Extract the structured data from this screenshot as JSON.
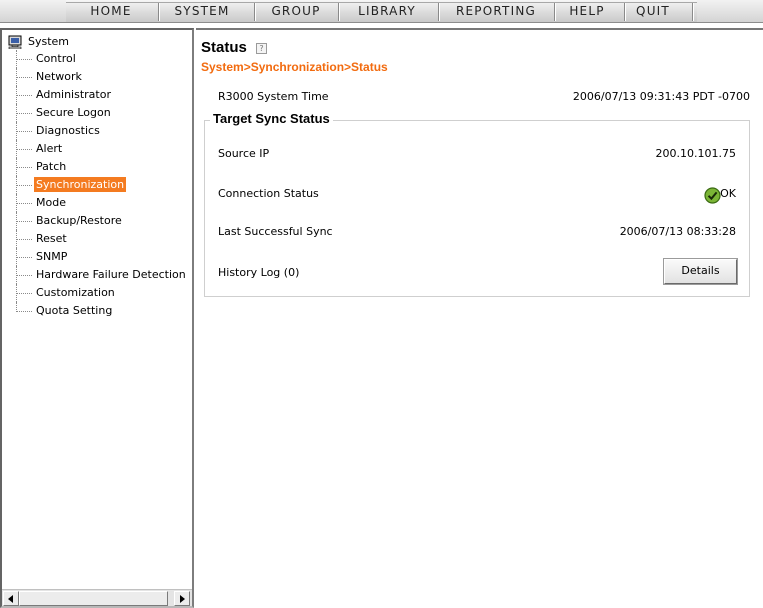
{
  "nav": {
    "items": [
      "HOME",
      "SYSTEM",
      "GROUP",
      "LIBRARY",
      "REPORTING",
      "HELP",
      "QUIT"
    ]
  },
  "tree": {
    "root": "System",
    "items": [
      "Control",
      "Network",
      "Administrator",
      "Secure Logon",
      "Diagnostics",
      "Alert",
      "Patch",
      "Synchronization",
      "Mode",
      "Backup/Restore",
      "Reset",
      "SNMP",
      "Hardware Failure Detection",
      "Customization",
      "Quota Setting"
    ],
    "selected": "Synchronization"
  },
  "page": {
    "title": "Status",
    "help_icon": "?",
    "breadcrumb": "System>Synchronization>Status",
    "system_time_label": "R3000 System Time",
    "system_time_value": "2006/07/13 09:31:43 PDT -0700"
  },
  "sync": {
    "legend": "Target Sync Status",
    "source_ip_label": "Source IP",
    "source_ip_value": "200.10.101.75",
    "connection_label": "Connection Status",
    "connection_value": "OK",
    "last_sync_label": "Last Successful Sync",
    "last_sync_value": "2006/07/13 08:33:28",
    "history_label": "History Log (0)",
    "details_button": "Details"
  },
  "colors": {
    "accent": "#f47b20",
    "breadcrumb": "#f26b0f",
    "ok": "#6aa321"
  },
  "icons": {
    "tree_root": "computer-icon",
    "ok": "check-circle-icon",
    "help": "help-icon"
  }
}
